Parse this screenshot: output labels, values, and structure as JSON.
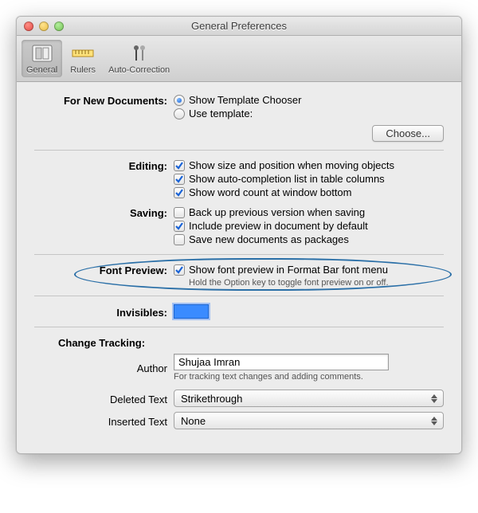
{
  "window": {
    "title": "General Preferences"
  },
  "toolbar": {
    "general": "General",
    "rulers": "Rulers",
    "autocorr": "Auto-Correction"
  },
  "newdocs": {
    "label": "For New Documents:",
    "opt1": "Show Template Chooser",
    "opt2": "Use template:",
    "choose": "Choose..."
  },
  "editing": {
    "label": "Editing:",
    "c1": "Show size and position when moving objects",
    "c2": "Show auto-completion list in table columns",
    "c3": "Show word count at window bottom"
  },
  "saving": {
    "label": "Saving:",
    "c1": "Back up previous version when saving",
    "c2": "Include preview in document by default",
    "c3": "Save new documents as packages"
  },
  "fontpreview": {
    "label": "Font Preview:",
    "c1": "Show font preview in Format Bar font menu",
    "hint": "Hold the Option key to toggle font preview on or off."
  },
  "invisibles": {
    "label": "Invisibles:"
  },
  "tracking": {
    "heading": "Change Tracking:",
    "author_label": "Author",
    "author_value": "Shujaa Imran",
    "author_hint": "For tracking text changes and adding comments.",
    "deleted_label": "Deleted Text",
    "deleted_value": "Strikethrough",
    "inserted_label": "Inserted Text",
    "inserted_value": "None"
  }
}
